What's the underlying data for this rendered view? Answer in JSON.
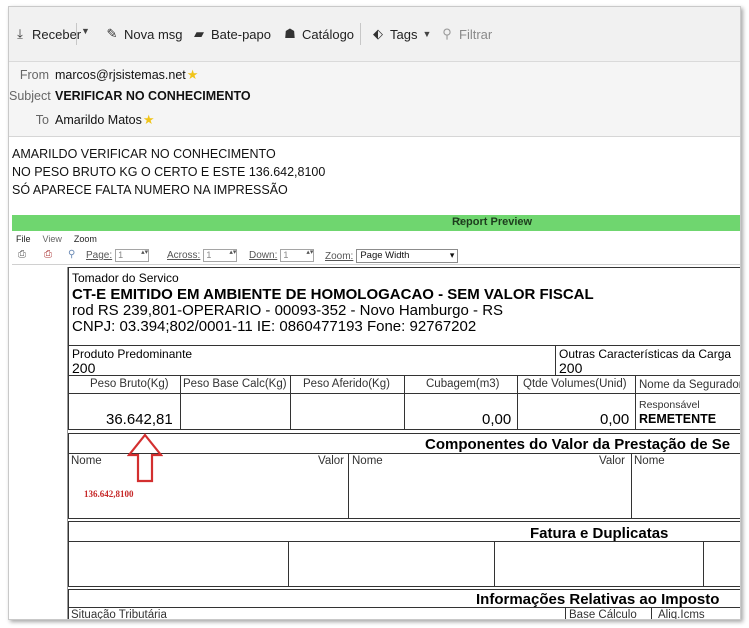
{
  "toolbar": {
    "receive_label": "Receber",
    "new_msg_label": "Nova msg",
    "chat_label": "Bate-papo",
    "catalog_label": "Catálogo",
    "tags_label": "Tags",
    "filter_label": "Filtrar"
  },
  "header": {
    "from_label": "From",
    "from_value": "marcos@rjsistemas.net",
    "subject_label": "Subject",
    "subject_value": "VERIFICAR NO CONHECIMENTO",
    "to_label": "To",
    "to_value": "Amarildo Matos"
  },
  "body": {
    "lines": [
      "AMARILDO VERIFICAR NO CONHECIMENTO",
      "NO PESO BRUTO KG  O CERTO E ESTE 136.642,8100",
      "SÓ APARECE FALTA NUMERO NA IMPRESSÃO"
    ]
  },
  "report": {
    "title": "Report Preview",
    "menu": [
      "File",
      "View",
      "Zoom"
    ],
    "page_label": "Page:",
    "page_value": "1",
    "across_label": "Across:",
    "across_value": "1",
    "down_label": "Down:",
    "down_value": "1",
    "zoom_label": "Zoom:",
    "zoom_value": "Page Width",
    "doc": {
      "tomador_label": "Tomador do Servico",
      "homologacao": "CT-E EMITIDO EM AMBIENTE DE HOMOLOGACAO - SEM VALOR FISCAL",
      "address": "rod RS 239,801-OPERARIO - 00093-352 - Novo Hamburgo - RS",
      "cnpj": "CNPJ: 03.394;802/0001-11 IE: 0860477193 Fone: 92767202",
      "produto_label": "Produto Predominante",
      "produto_value": "200",
      "outras_label": "Outras Características da Carga",
      "outras_value": "200",
      "col_peso_bruto": "Peso Bruto(Kg)",
      "col_peso_base": "Peso Base Calc(Kg)",
      "col_peso_aferido": "Peso Aferido(Kg)",
      "col_cubagem": "Cubagem(m3)",
      "col_qtde": "Qtde Volumes(Unid)",
      "col_seguradora": "Nome da Seguradora",
      "peso_bruto_value": "36.642,81",
      "cubagem_value": "0,00",
      "qtde_value": "0,00",
      "responsavel_label": "Responsável",
      "responsavel_value": "REMETENTE",
      "componentes_title": "Componentes do Valor da Prestação de Se",
      "nome_label": "Nome",
      "valor_label": "Valor",
      "annotation": "136.642,8100",
      "fatura_title": "Fatura e Duplicatas",
      "impostos_title": "Informações Relativas ao Imposto",
      "situacao_label": "Situação Tributária",
      "base_calc_label": "Base Cálculo",
      "aliq_label": "Aliq.Icms"
    }
  },
  "colors": {
    "preview_title_bg": "#6fd66f",
    "annotation": "#c62828",
    "star": "#f0c419"
  }
}
